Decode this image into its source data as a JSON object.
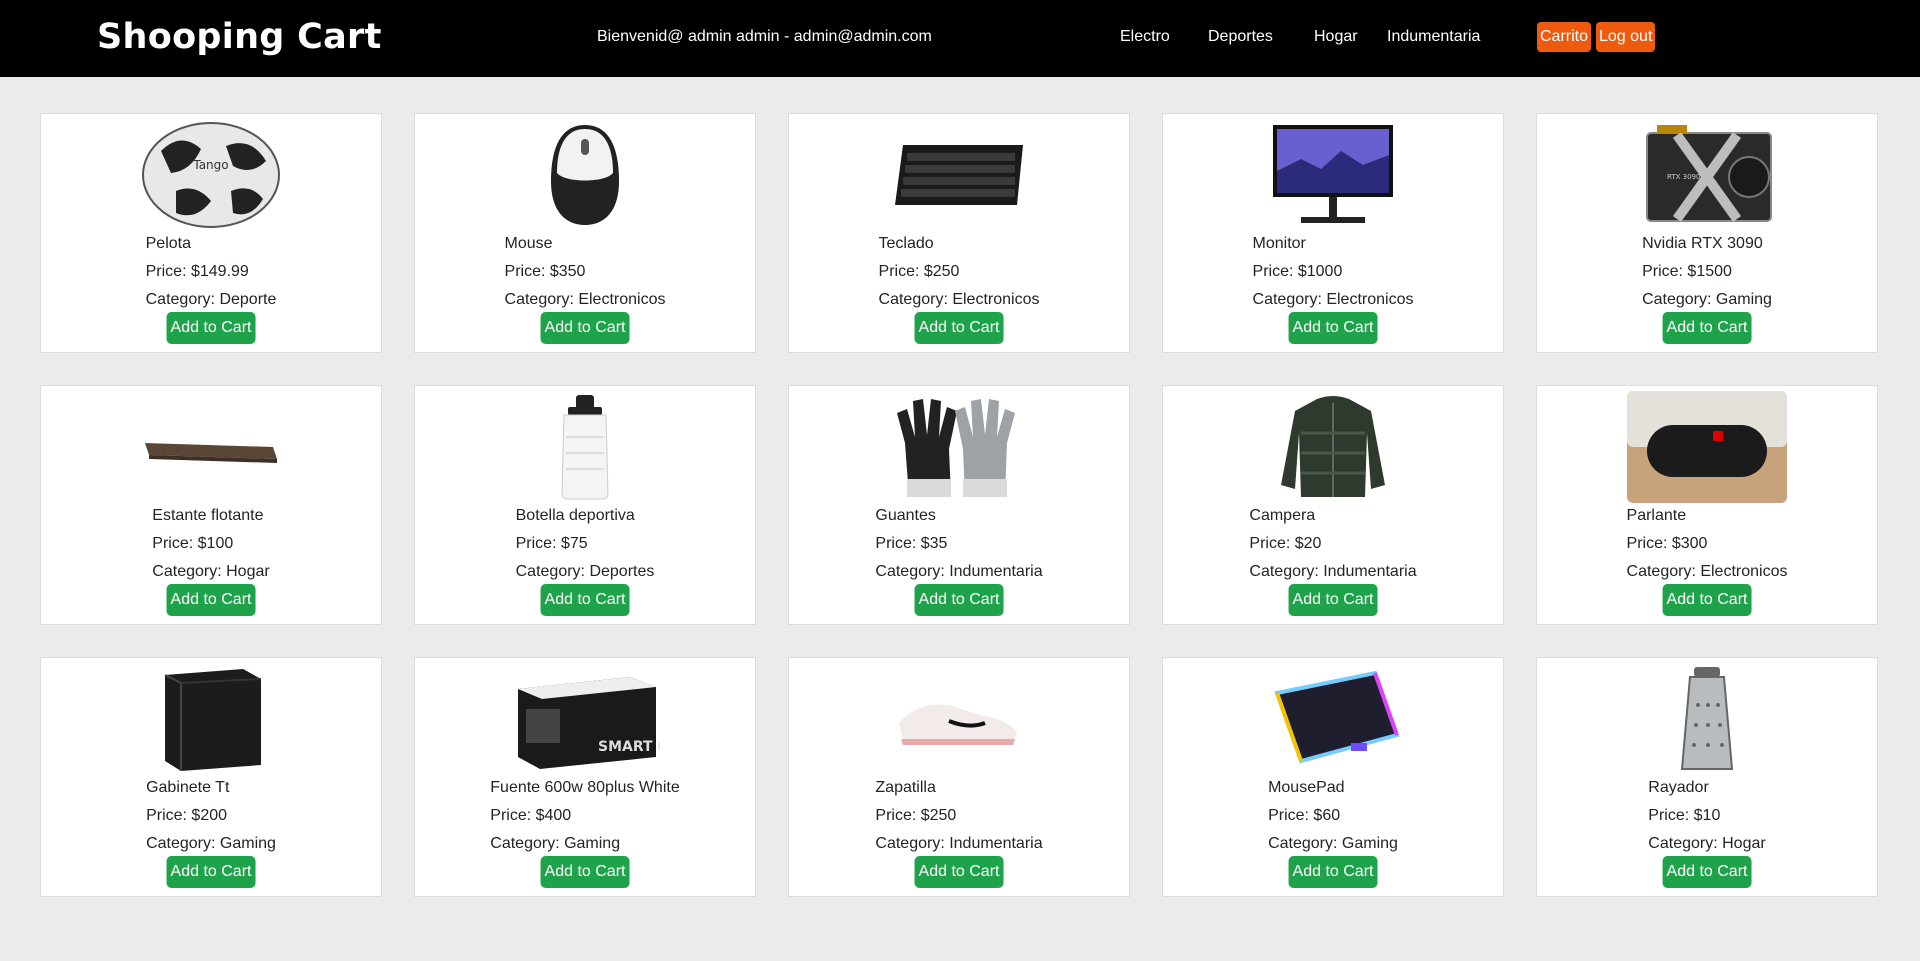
{
  "header": {
    "brand": "Shooping Cart",
    "welcome": "Bienvenid@ admin admin - admin@admin.com",
    "nav": [
      "Electro",
      "Deportes",
      "Hogar",
      "Indumentaria"
    ],
    "cart_label": "Carrito",
    "logout_label": "Log out"
  },
  "colors": {
    "header_bg": "#000000",
    "orange": "#ee5a0e",
    "green": "#1fa34a",
    "page_bg": "#ebebeb"
  },
  "labels": {
    "price_prefix": "Price: ",
    "category_prefix": "Category: ",
    "add_to_cart": "Add to Cart"
  },
  "products": [
    {
      "name": "Pelota",
      "price": "$149.99",
      "category": "Deporte",
      "icon": "soccer-ball"
    },
    {
      "name": "Mouse",
      "price": "$350",
      "category": "Electronicos",
      "icon": "mouse"
    },
    {
      "name": "Teclado",
      "price": "$250",
      "category": "Electronicos",
      "icon": "keyboard"
    },
    {
      "name": "Monitor",
      "price": "$1000",
      "category": "Electronicos",
      "icon": "monitor"
    },
    {
      "name": "Nvidia RTX 3090",
      "price": "$1500",
      "category": "Gaming",
      "icon": "graphics-card"
    },
    {
      "name": "Estante flotante",
      "price": "$100",
      "category": "Hogar",
      "icon": "shelf"
    },
    {
      "name": "Botella deportiva",
      "price": "$75",
      "category": "Deportes",
      "icon": "bottle"
    },
    {
      "name": "Guantes",
      "price": "$35",
      "category": "Indumentaria",
      "icon": "gloves"
    },
    {
      "name": "Campera",
      "price": "$20",
      "category": "Indumentaria",
      "icon": "jacket"
    },
    {
      "name": "Parlante",
      "price": "$300",
      "category": "Electronicos",
      "icon": "speaker"
    },
    {
      "name": "Gabinete Tt",
      "price": "$200",
      "category": "Gaming",
      "icon": "pc-case"
    },
    {
      "name": "Fuente 600w 80plus White",
      "price": "$400",
      "category": "Gaming",
      "icon": "power-supply"
    },
    {
      "name": "Zapatilla",
      "price": "$250",
      "category": "Indumentaria",
      "icon": "sneaker"
    },
    {
      "name": "MousePad",
      "price": "$60",
      "category": "Gaming",
      "icon": "mousepad"
    },
    {
      "name": "Rayador",
      "price": "$10",
      "category": "Hogar",
      "icon": "grater"
    }
  ]
}
